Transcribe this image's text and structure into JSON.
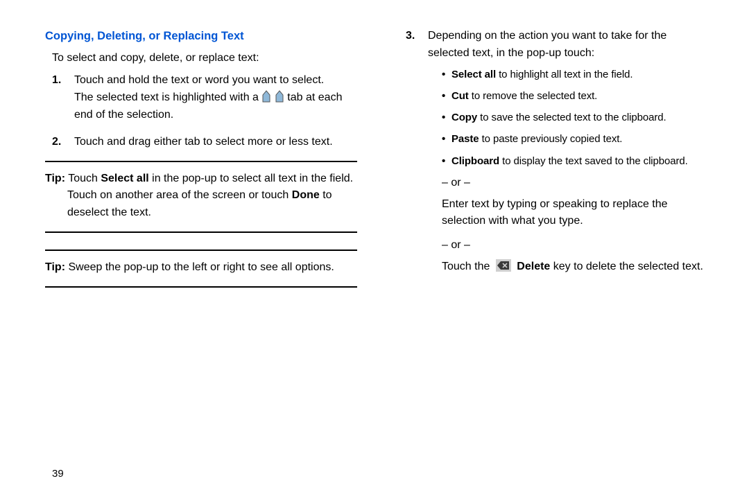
{
  "section_title": "Copying, Deleting, or Replacing Text",
  "intro": "To select and copy, delete, or replace text:",
  "step1_a": "Touch and hold the text or word you want to select.",
  "step1_b": "The selected text is highlighted with a",
  "step1_c": "tab at each end of the selection.",
  "step2": "Touch and drag either tab to select more or less text.",
  "tip1": {
    "label": "Tip:",
    "a": "Touch ",
    "b": "Select all",
    "c": " in the pop-up to select all text in the field.",
    "d": "Touch on another area of the screen or touch ",
    "e": "Done",
    "f": " to deselect the text."
  },
  "tip2": {
    "label": "Tip:",
    "text": "Sweep the pop-up to the left or right to see all options."
  },
  "step3": "Depending on the action you want to take for the selected text, in the pop-up touch:",
  "opts": {
    "selectall_b": "Select all",
    "selectall_t": " to highlight all text in the field.",
    "cut_b": "Cut",
    "cut_t": " to remove the selected text.",
    "copy_b": "Copy",
    "copy_t": " to save the selected text to the clipboard.",
    "paste_b": "Paste",
    "paste_t": " to paste previously copied text.",
    "clip_b": "Clipboard",
    "clip_t": " to display the text saved to the clipboard."
  },
  "or": "– or –",
  "enter_text": "Enter text by typing or speaking to replace the selection with what you type.",
  "touch_the": "Touch the",
  "delete_b": "Delete",
  "delete_t": " key to delete the selected text.",
  "page_number": "39"
}
